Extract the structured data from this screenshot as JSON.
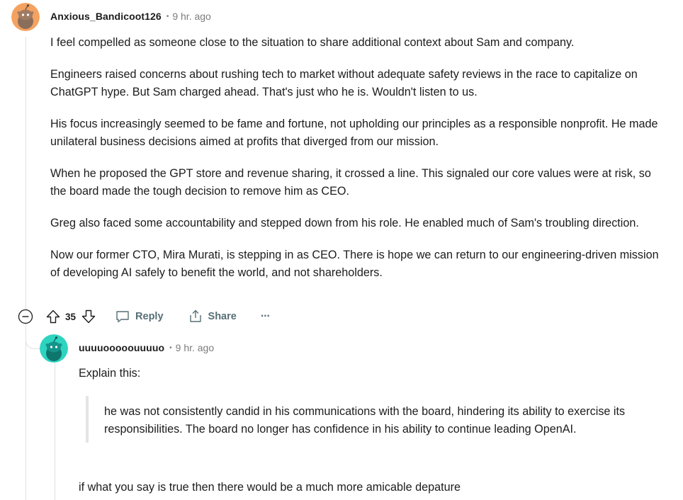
{
  "comment": {
    "username": "Anxious_Bandicoot126",
    "separator": "•",
    "timestamp": "9 hr. ago",
    "paragraphs": [
      "I feel compelled as someone close to the situation to share additional context about Sam and company.",
      "Engineers raised concerns about rushing tech to market without adequate safety reviews in the race to capitalize on ChatGPT hype. But Sam charged ahead. That's just who he is. Wouldn't listen to us.",
      "His focus increasingly seemed to be fame and fortune, not upholding our principles as a responsible nonprofit. He made unilateral business decisions aimed at profits that diverged from our mission.",
      "When he proposed the GPT store and revenue sharing, it crossed a line. This signaled our core values were at risk, so the board made the tough decision to remove him as CEO.",
      "Greg also faced some accountability and stepped down from his role. He enabled much of Sam's troubling direction.",
      "Now our former CTO, Mira Murati, is stepping in as CEO. There is hope we can return to our engineering-driven mission of developing AI safely to benefit the world, and not shareholders."
    ],
    "actions": {
      "collapse_icon": "collapse-minus-icon",
      "upvote_icon": "upvote-arrow-icon",
      "score": "35",
      "downvote_icon": "downvote-arrow-icon",
      "reply_label": "Reply",
      "reply_icon": "speech-bubble-icon",
      "share_label": "Share",
      "share_icon": "share-upload-icon",
      "more_label": "···"
    },
    "avatar_color": "#f4a261"
  },
  "reply": {
    "username": "uuuuooooouuuuo",
    "separator": "•",
    "timestamp": "9 hr. ago",
    "intro": "Explain this:",
    "quote": "he was not consistently candid in his communications with the board, hindering its ability to exercise its responsibilities. The board no longer has confidence in his ability to continue leading OpenAI.",
    "closing": "if what you say is true then there would be a much more amicable depature",
    "avatar_color": "#2dd4bf"
  },
  "colors": {
    "text": "#1c1c1c",
    "muted": "#7c7c7c",
    "action": "#576f76",
    "thread_line": "#e0e0e0"
  }
}
